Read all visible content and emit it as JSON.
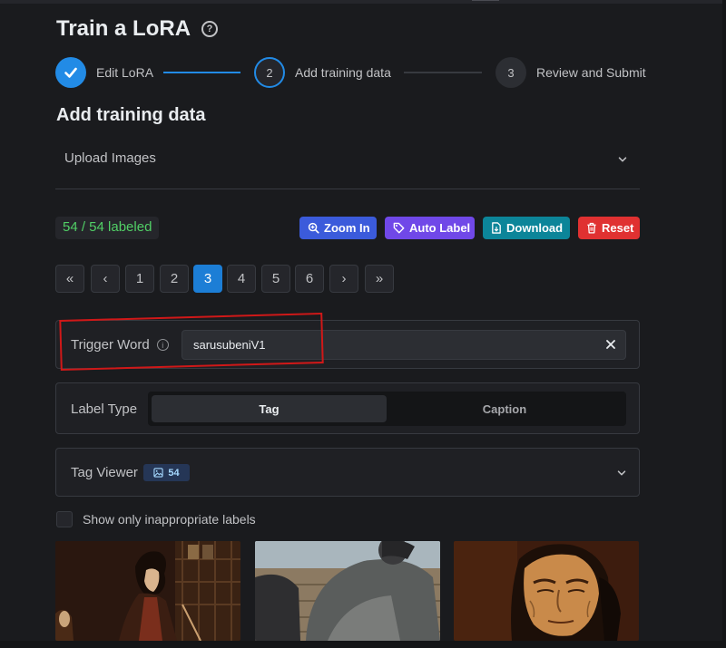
{
  "page": {
    "title": "Train a LoRA",
    "help_icon": "question-circle-icon"
  },
  "stepper": {
    "steps": [
      {
        "number": "1",
        "label": "Edit LoRA",
        "state": "completed"
      },
      {
        "number": "2",
        "label": "Add training data",
        "state": "active"
      },
      {
        "number": "3",
        "label": "Review and Submit",
        "state": "pending"
      }
    ]
  },
  "section": {
    "title": "Add training data"
  },
  "upload": {
    "label": "Upload Images"
  },
  "toolbar": {
    "labeled_status": "54 / 54 labeled",
    "zoom_in": "Zoom In",
    "auto_label": "Auto Label",
    "download": "Download",
    "reset": "Reset"
  },
  "pagination": {
    "first": "«",
    "prev": "‹",
    "pages": [
      "1",
      "2",
      "3",
      "4",
      "5",
      "6"
    ],
    "current": "3",
    "next": "›",
    "last": "»"
  },
  "trigger": {
    "label": "Trigger Word",
    "value": "sarusubeniV1"
  },
  "label_type": {
    "label": "Label Type",
    "options": [
      "Tag",
      "Caption"
    ],
    "selected": "Tag"
  },
  "tag_viewer": {
    "label": "Tag Viewer",
    "count": "54"
  },
  "filter": {
    "label": "Show only inappropriate labels",
    "checked": false
  },
  "colors": {
    "background": "#1a1b1e",
    "accent_blue": "#228be6",
    "labeled_green": "#51cf66",
    "zoom_btn": "#3b5bdb",
    "auto_label_btn": "#7048e8",
    "download_btn": "#0c8599",
    "reset_btn": "#e03131",
    "annotation_red": "#d01818"
  }
}
